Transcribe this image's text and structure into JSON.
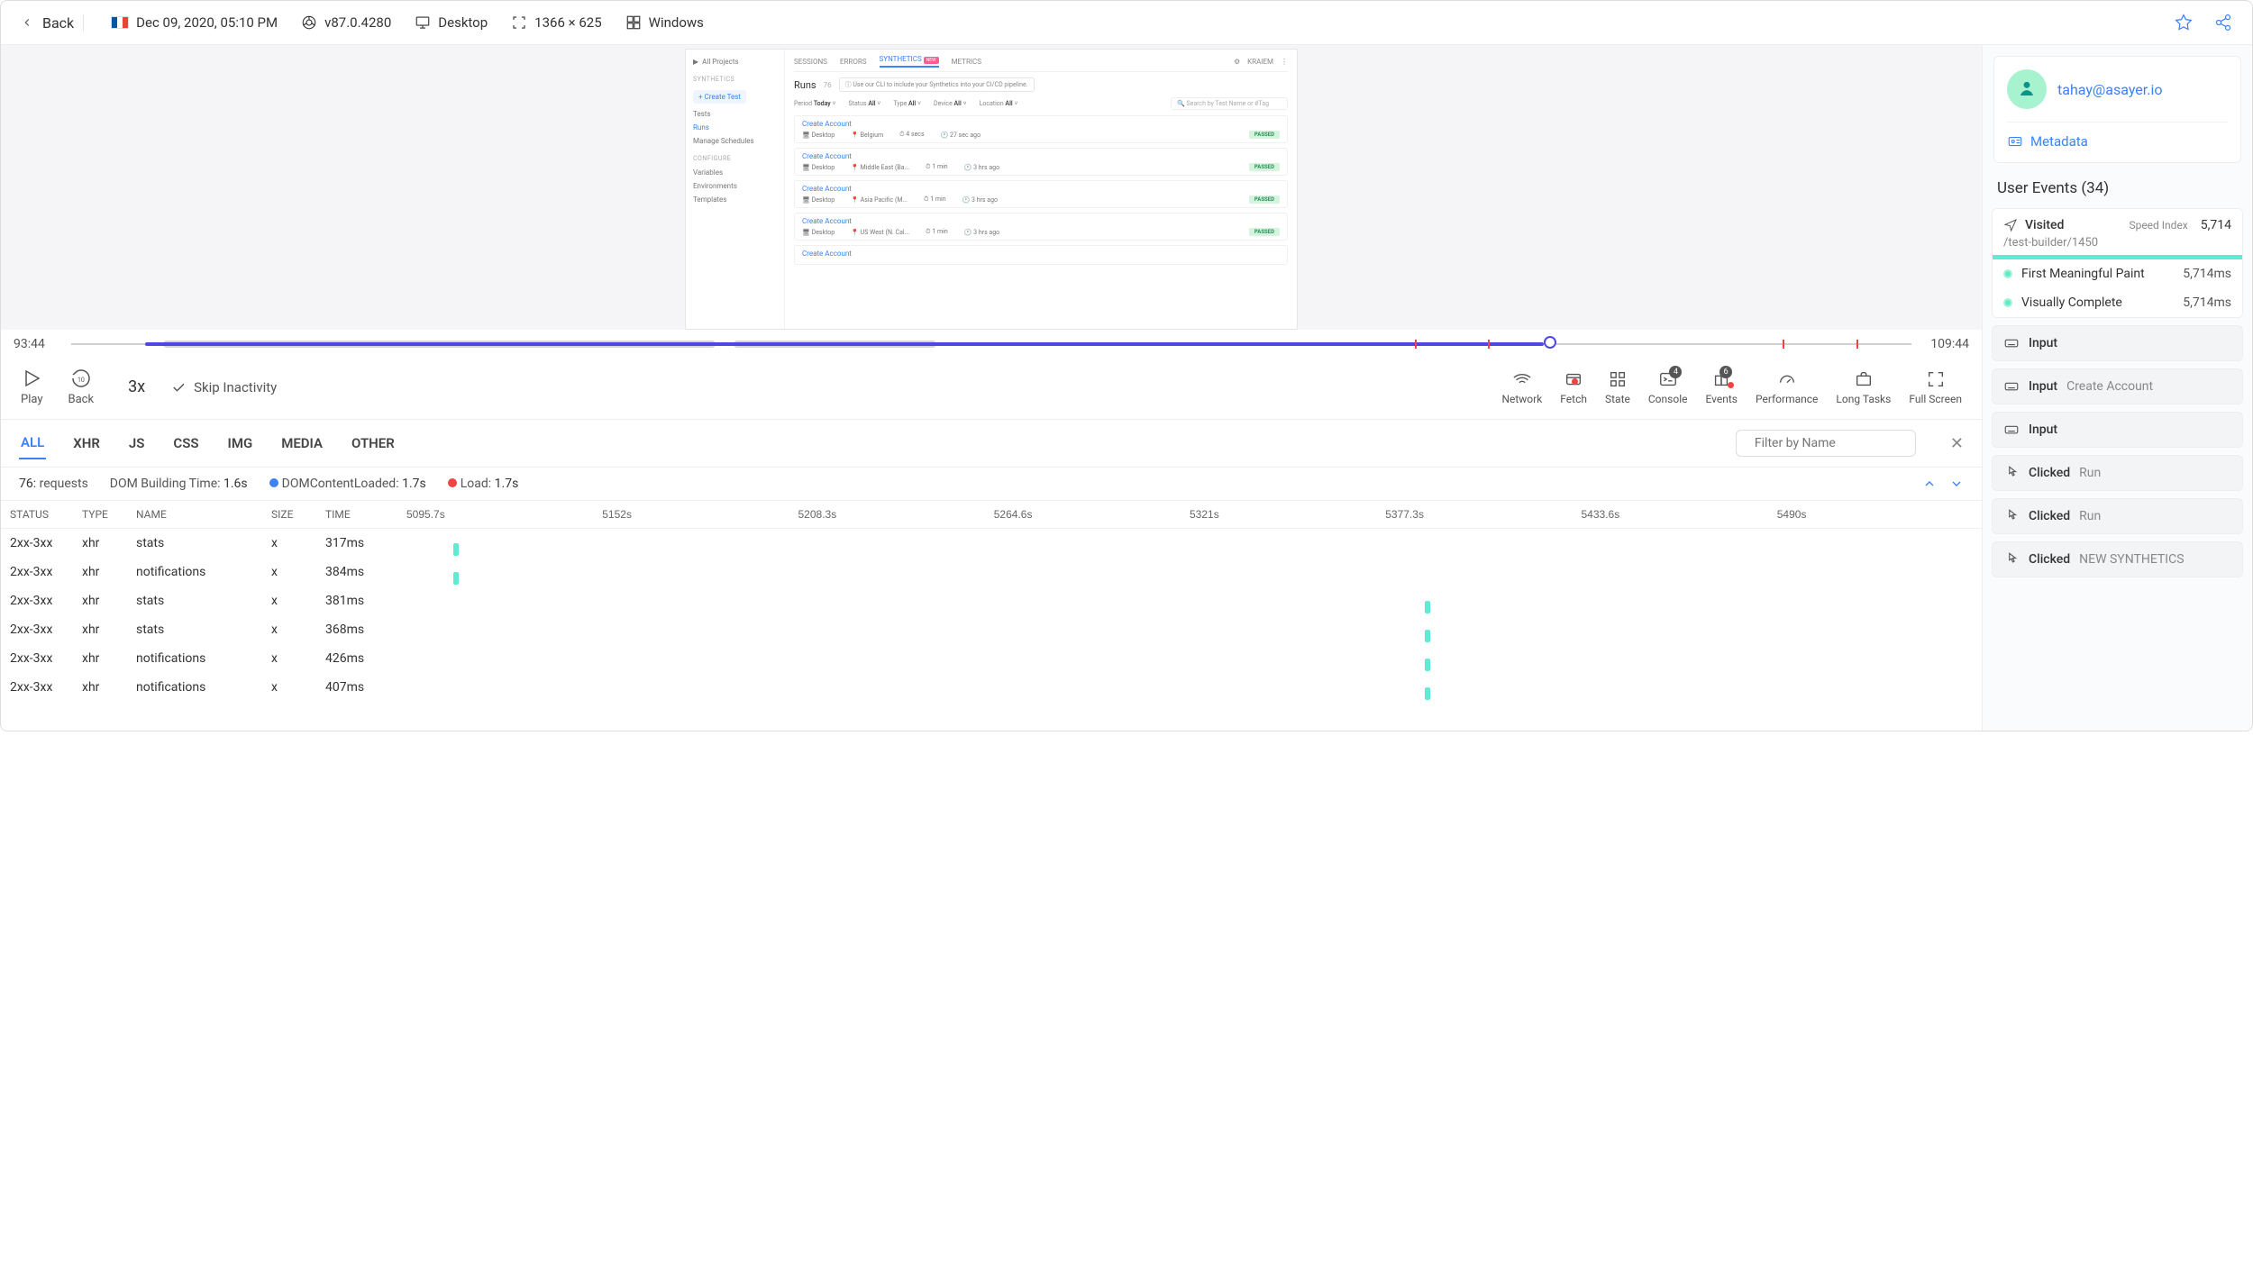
{
  "topbar": {
    "back": "Back",
    "date": "Dec 09, 2020, 05:10 PM",
    "browser": "v87.0.4280",
    "device": "Desktop",
    "resolution": "1366 × 625",
    "os": "Windows"
  },
  "replay": {
    "sidebar": {
      "projects": "All Projects",
      "section1": "SYNTHETICS",
      "create": "+ Create Test",
      "items1": [
        "Tests",
        "Runs",
        "Manage Schedules"
      ],
      "section2": "CONFIGURE",
      "items2": [
        "Variables",
        "Environments",
        "Templates"
      ]
    },
    "header": {
      "tabs": [
        "SESSIONS",
        "ERRORS",
        "SYNTHETICS",
        "METRICS"
      ],
      "new_badge": "NEW",
      "user": "KRAIEM"
    },
    "runs": {
      "title": "Runs",
      "count": "76",
      "cli_text": "Use our CLI to include your Synthetics into your CI/CD pipeline.",
      "filters": {
        "period_label": "Period",
        "period_val": "Today",
        "status_label": "Status",
        "status_val": "All",
        "type_label": "Type",
        "type_val": "All",
        "device_label": "Device",
        "device_val": "All",
        "location_label": "Location",
        "location_val": "All"
      },
      "search_placeholder": "Search by Test Name or #Tag",
      "rows": [
        {
          "name": "Create Account",
          "device": "Desktop",
          "location": "Belgium",
          "duration": "4 secs",
          "ago": "27 sec ago",
          "status": "PASSED"
        },
        {
          "name": "Create Account",
          "device": "Desktop",
          "location": "Middle East (Ba...",
          "duration": "1 min",
          "ago": "3 hrs ago",
          "status": "PASSED"
        },
        {
          "name": "Create Account",
          "device": "Desktop",
          "location": "Asia Pacific (M...",
          "duration": "1 min",
          "ago": "3 hrs ago",
          "status": "PASSED"
        },
        {
          "name": "Create Account",
          "device": "Desktop",
          "location": "US West (N. Cal...",
          "duration": "1 min",
          "ago": "3 hrs ago",
          "status": "PASSED"
        },
        {
          "name": "Create Account",
          "device": "",
          "location": "",
          "duration": "",
          "ago": "",
          "status": ""
        }
      ]
    }
  },
  "timeline": {
    "start": "93:44",
    "end": "109:44"
  },
  "controls": {
    "play": "Play",
    "back": "Back",
    "speed": "3x",
    "skip": "Skip Inactivity",
    "tools": {
      "network": "Network",
      "fetch": "Fetch",
      "state": "State",
      "console": "Console",
      "console_badge": "4",
      "events": "Events",
      "events_badge": "6",
      "performance": "Performance",
      "longtasks": "Long Tasks",
      "fullscreen": "Full Screen"
    }
  },
  "network": {
    "tabs": [
      "ALL",
      "XHR",
      "JS",
      "CSS",
      "IMG",
      "MEDIA",
      "OTHER"
    ],
    "filter_placeholder": "Filter by Name",
    "stats": {
      "requests_count": "76:",
      "requests_label": "requests",
      "dom_build_label": "DOM Building Time:",
      "dom_build_val": "1.6s",
      "dcl_label": "DOMContentLoaded:",
      "dcl_val": "1.7s",
      "load_label": "Load:",
      "load_val": "1.7s"
    },
    "columns": [
      "STATUS",
      "TYPE",
      "NAME",
      "SIZE",
      "TIME"
    ],
    "ticks": [
      "5095.7s",
      "5152s",
      "5208.3s",
      "5264.6s",
      "5321s",
      "5377.3s",
      "5433.6s",
      "5490s"
    ],
    "rows": [
      {
        "status": "2xx-3xx",
        "type": "xhr",
        "name": "stats",
        "size": "x",
        "time": "317ms",
        "wf_left": "3%"
      },
      {
        "status": "2xx-3xx",
        "type": "xhr",
        "name": "notifications",
        "size": "x",
        "time": "384ms",
        "wf_left": "3%"
      },
      {
        "status": "2xx-3xx",
        "type": "xhr",
        "name": "stats",
        "size": "x",
        "time": "381ms",
        "wf_left": "65%"
      },
      {
        "status": "2xx-3xx",
        "type": "xhr",
        "name": "stats",
        "size": "x",
        "time": "368ms",
        "wf_left": "65%"
      },
      {
        "status": "2xx-3xx",
        "type": "xhr",
        "name": "notifications",
        "size": "x",
        "time": "426ms",
        "wf_left": "65%"
      },
      {
        "status": "2xx-3xx",
        "type": "xhr",
        "name": "notifications",
        "size": "x",
        "time": "407ms",
        "wf_left": "65%"
      }
    ]
  },
  "sidebar": {
    "email": "tahay@asayer.io",
    "metadata": "Metadata",
    "user_events_title": "User Events (34)",
    "visited": {
      "label": "Visited",
      "speed_index_label": "Speed Index",
      "speed_index_val": "5,714",
      "path": "/test-builder/1450",
      "metrics": [
        {
          "label": "First Meaningful Paint",
          "val": "5,714ms"
        },
        {
          "label": "Visually Complete",
          "val": "5,714ms"
        }
      ]
    },
    "actions": [
      {
        "type": "Input",
        "target": ""
      },
      {
        "type": "Input",
        "target": "Create Account"
      },
      {
        "type": "Input",
        "target": ""
      },
      {
        "type": "Clicked",
        "target": "Run"
      },
      {
        "type": "Clicked",
        "target": "Run"
      },
      {
        "type": "Clicked",
        "target": "NEW SYNTHETICS"
      }
    ]
  }
}
